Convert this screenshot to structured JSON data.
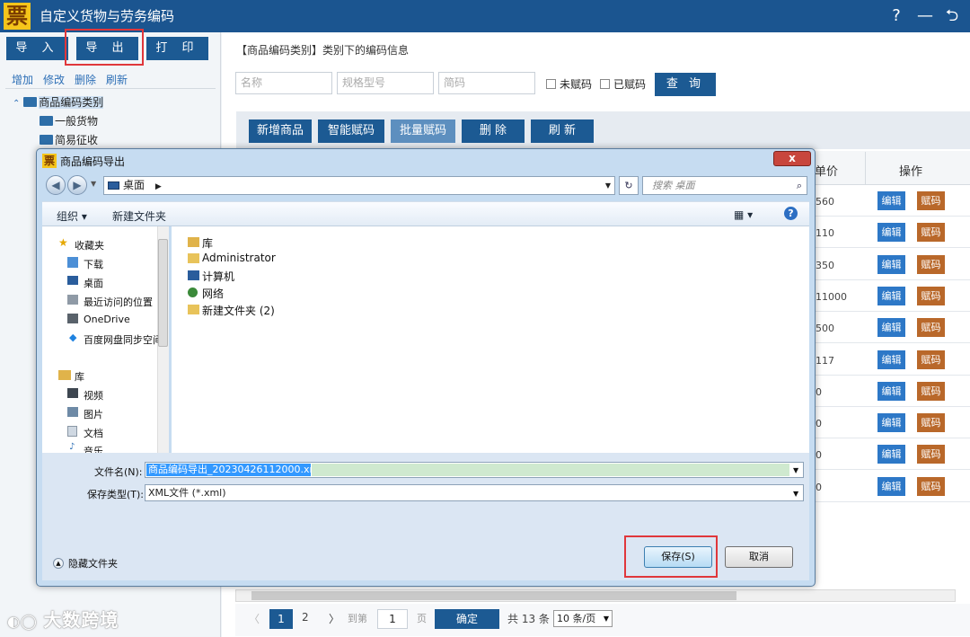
{
  "app": {
    "logo_char": "票",
    "title": "自定义货物与劳务编码",
    "controls": {
      "help": "?",
      "minimize": "—",
      "back": "⮌"
    }
  },
  "left": {
    "buttons": {
      "import": "导 入",
      "export": "导 出",
      "print": "打 印"
    },
    "actions": {
      "add": "增加",
      "edit": "修改",
      "delete": "删除",
      "refresh": "刷新"
    },
    "tree": {
      "root": "商品编码类别",
      "children": [
        "一般货物",
        "简易征收"
      ]
    }
  },
  "right": {
    "section_title": "【商品编码类别】类别下的编码信息",
    "filters": {
      "name_placeholder": "名称",
      "spec_placeholder": "规格型号",
      "code_placeholder": "简码",
      "unassigned": "未赋码",
      "assigned": "已赋码",
      "query": "查 询"
    },
    "toolbar": {
      "add": "新增商品",
      "smart": "智能赋码",
      "batch": "批量赋码",
      "delete": "删 除",
      "refresh": "刷 新"
    },
    "table": {
      "col_price": "单价",
      "col_action": "操作",
      "prices": [
        "560",
        "110",
        "350",
        "11000",
        "500",
        "117",
        "0",
        "0",
        "0",
        "0"
      ],
      "edit_label": "编辑",
      "assign_label": "赋码"
    },
    "pager": {
      "prev": "〈",
      "page1": "1",
      "page2": "2",
      "next": "〉",
      "goto_label": "到第",
      "goto_value": "1",
      "page_suffix": "页",
      "confirm": "确定",
      "total": "共 13 条",
      "per_page": "10 条/页"
    }
  },
  "dialog": {
    "title": "商品编码导出",
    "close": "x",
    "address": "桌面",
    "search_placeholder": "搜索 桌面",
    "organize": "组织 ▾",
    "new_folder": "新建文件夹",
    "nav": {
      "favorites": "收藏夹",
      "fav_items": [
        "下载",
        "桌面",
        "最近访问的位置",
        "OneDrive",
        "百度网盘同步空间"
      ],
      "libraries": "库",
      "lib_items": [
        "视频",
        "图片",
        "文档",
        "音乐"
      ]
    },
    "files": [
      "库",
      "Administrator",
      "计算机",
      "网络",
      "新建文件夹 (2)"
    ],
    "filename_label": "文件名(N):",
    "filename_value": "商品编码导出_20230426112000.xml",
    "filetype_label": "保存类型(T):",
    "filetype_value": "XML文件 (*.xml)",
    "hide_folders": "隐藏文件夹",
    "save": "保存(S)",
    "cancel": "取消"
  },
  "watermark": "大数跨境",
  "colors": {
    "brand": "#1b5590",
    "button": "#1c5a93",
    "edit": "#2d78c7",
    "assign": "#b9682a",
    "highlight": "#e0373b"
  }
}
